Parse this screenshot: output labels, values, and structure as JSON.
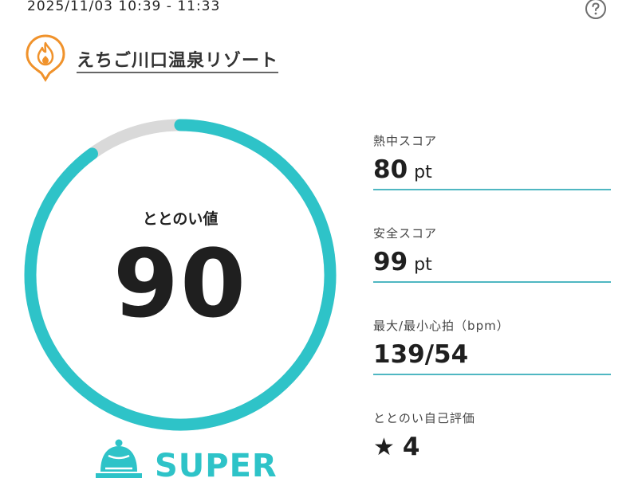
{
  "header": {
    "datetime": "2025/11/03 10:39 - 11:33",
    "help_icon": "help-circle-icon"
  },
  "facility": {
    "icon": "flame-pin-icon",
    "name": "えちご川口温泉リゾート"
  },
  "totonoi": {
    "label": "ととのい値",
    "value": "90",
    "progress": 0.9,
    "accent_color": "#2ec3c8",
    "track_color": "#d9d9d9",
    "rank": "SUPER",
    "rank_icon": "sauna-hat-icon"
  },
  "stats": [
    {
      "label": "熱中スコア",
      "value": "80",
      "unit": "pt"
    },
    {
      "label": "安全スコア",
      "value": "99",
      "unit": "pt"
    },
    {
      "label": "最大/最小心拍（bpm）",
      "value": "139/54",
      "unit": ""
    },
    {
      "label": "ととのい自己評価",
      "value": "4",
      "unit": "",
      "icon": "star-icon",
      "star_glyph": "★"
    }
  ]
}
